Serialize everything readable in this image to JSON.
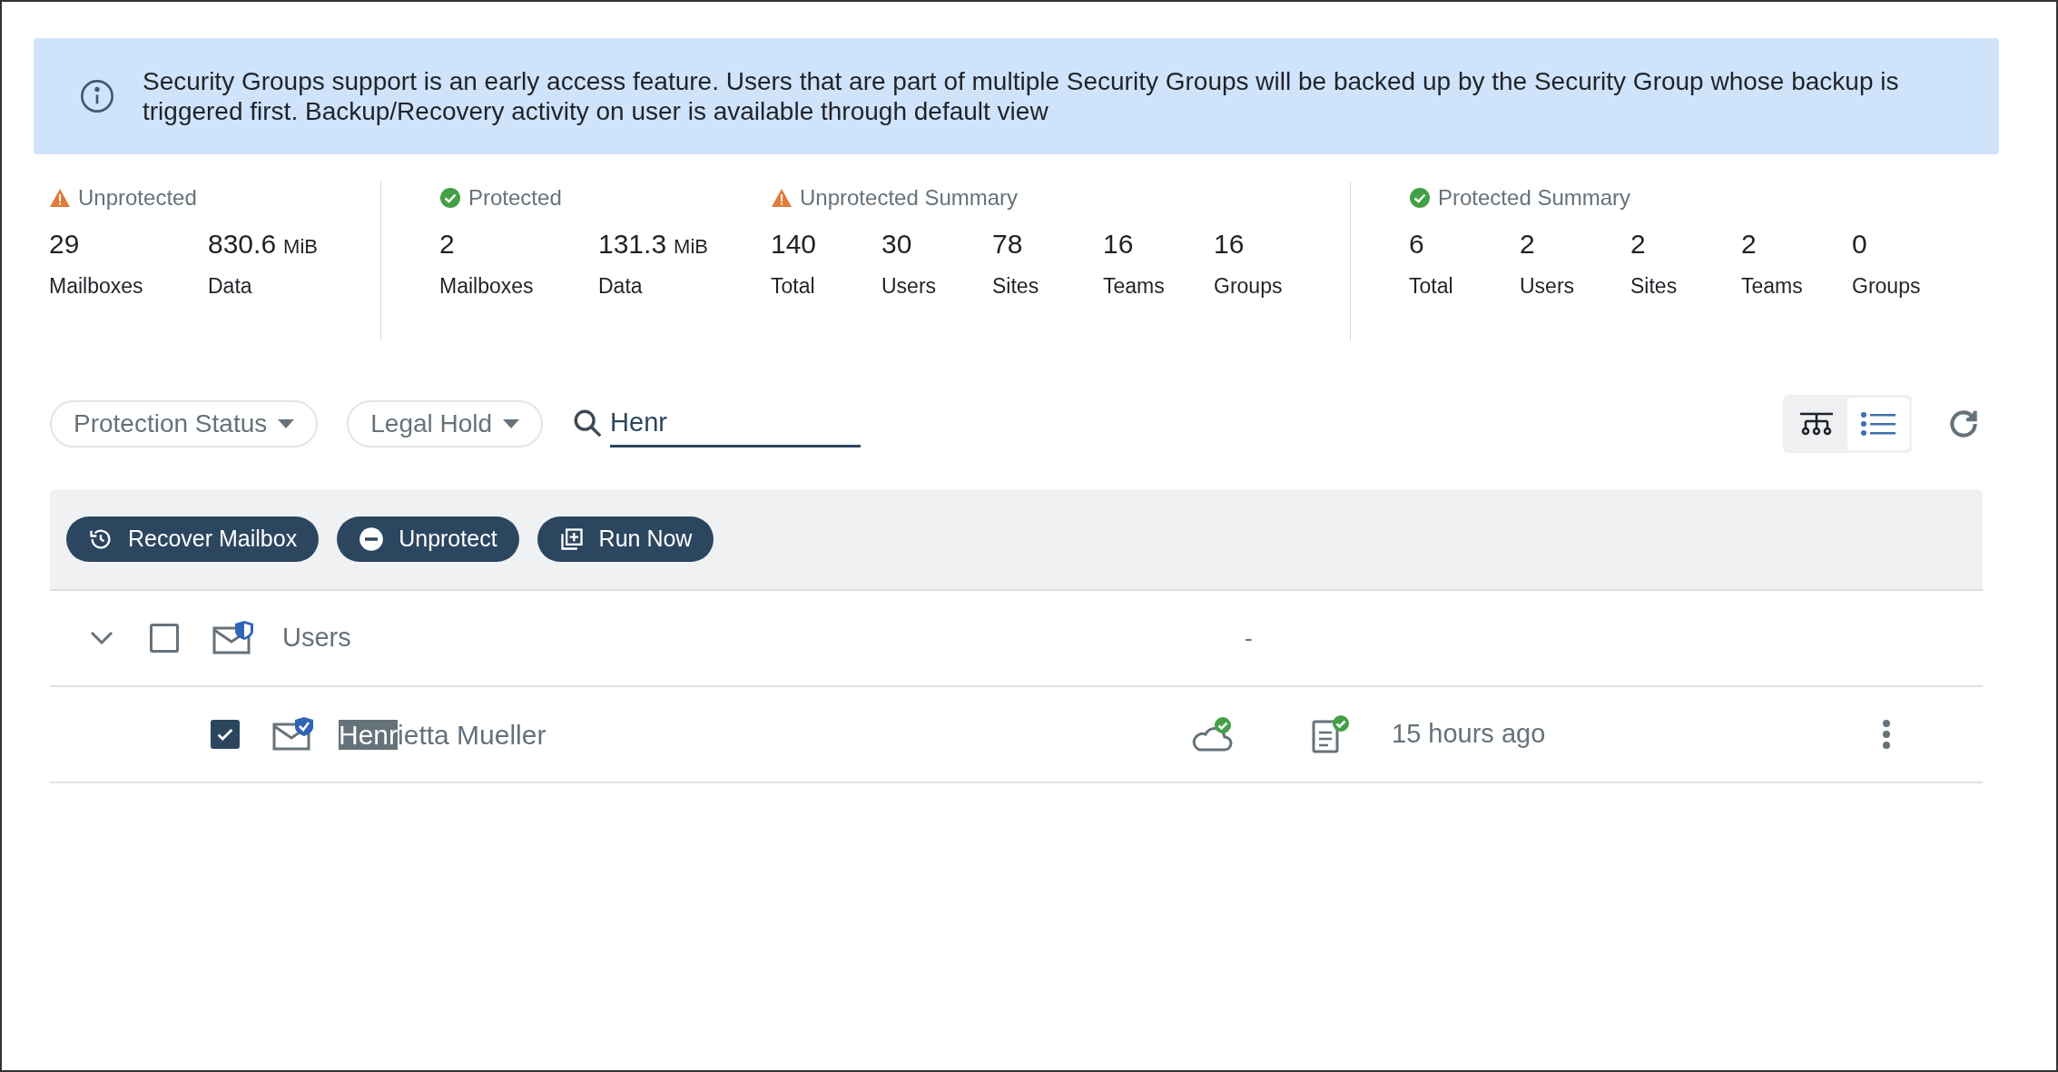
{
  "banner": {
    "text": "Security Groups support is an early access feature. Users that are part of multiple Security Groups will be backed up by the Security Group whose backup is triggered first. Backup/Recovery activity on user is available through default view"
  },
  "stats": [
    {
      "kind": "warning",
      "title": "Unprotected",
      "items": [
        {
          "value": "29",
          "label": "Mailboxes"
        },
        {
          "value": "830.6",
          "unit": "MiB",
          "label": "Data"
        }
      ]
    },
    {
      "kind": "ok",
      "title": "Protected",
      "items": [
        {
          "value": "2",
          "label": "Mailboxes"
        },
        {
          "value": "131.3",
          "unit": "MiB",
          "label": "Data"
        }
      ]
    },
    {
      "kind": "warning",
      "title": "Unprotected Summary",
      "items": [
        {
          "value": "140",
          "label": "Total"
        },
        {
          "value": "30",
          "label": "Users"
        },
        {
          "value": "78",
          "label": "Sites"
        },
        {
          "value": "16",
          "label": "Teams"
        },
        {
          "value": "16",
          "label": "Groups"
        }
      ]
    },
    {
      "kind": "ok",
      "title": "Protected Summary",
      "items": [
        {
          "value": "6",
          "label": "Total"
        },
        {
          "value": "2",
          "label": "Users"
        },
        {
          "value": "2",
          "label": "Sites"
        },
        {
          "value": "2",
          "label": "Teams"
        },
        {
          "value": "0",
          "label": "Groups"
        }
      ]
    }
  ],
  "filters": [
    "Protection Status",
    "Legal Hold"
  ],
  "search": {
    "value": "Henr"
  },
  "views": [
    {
      "kind": "tree",
      "selected": false
    },
    {
      "kind": "list",
      "selected": true
    }
  ],
  "actions": [
    {
      "kind": "recover",
      "label": "Recover Mailbox"
    },
    {
      "kind": "unprotect",
      "label": "Unprotect"
    },
    {
      "kind": "run",
      "label": "Run Now"
    }
  ],
  "rows": [
    {
      "kind": "group",
      "expanded": true,
      "checked": false,
      "label": "Users",
      "column_4": "-"
    },
    {
      "kind": "item",
      "checked": true,
      "name_match": "Henr",
      "name_rest": "ietta Mueller",
      "time": "15 hours ago"
    }
  ]
}
